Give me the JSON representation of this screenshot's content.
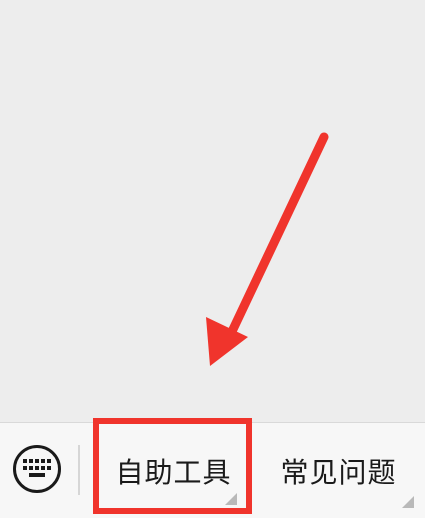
{
  "menu_bar": {
    "keyboard_toggle_icon": "keyboard-icon",
    "items": [
      {
        "label": "自助工具",
        "has_submenu": true,
        "highlighted": true
      },
      {
        "label": "常见问题",
        "has_submenu": true,
        "highlighted": false
      }
    ]
  },
  "annotation": {
    "color": "#f0342c",
    "arrow_icon": "red-arrow"
  }
}
